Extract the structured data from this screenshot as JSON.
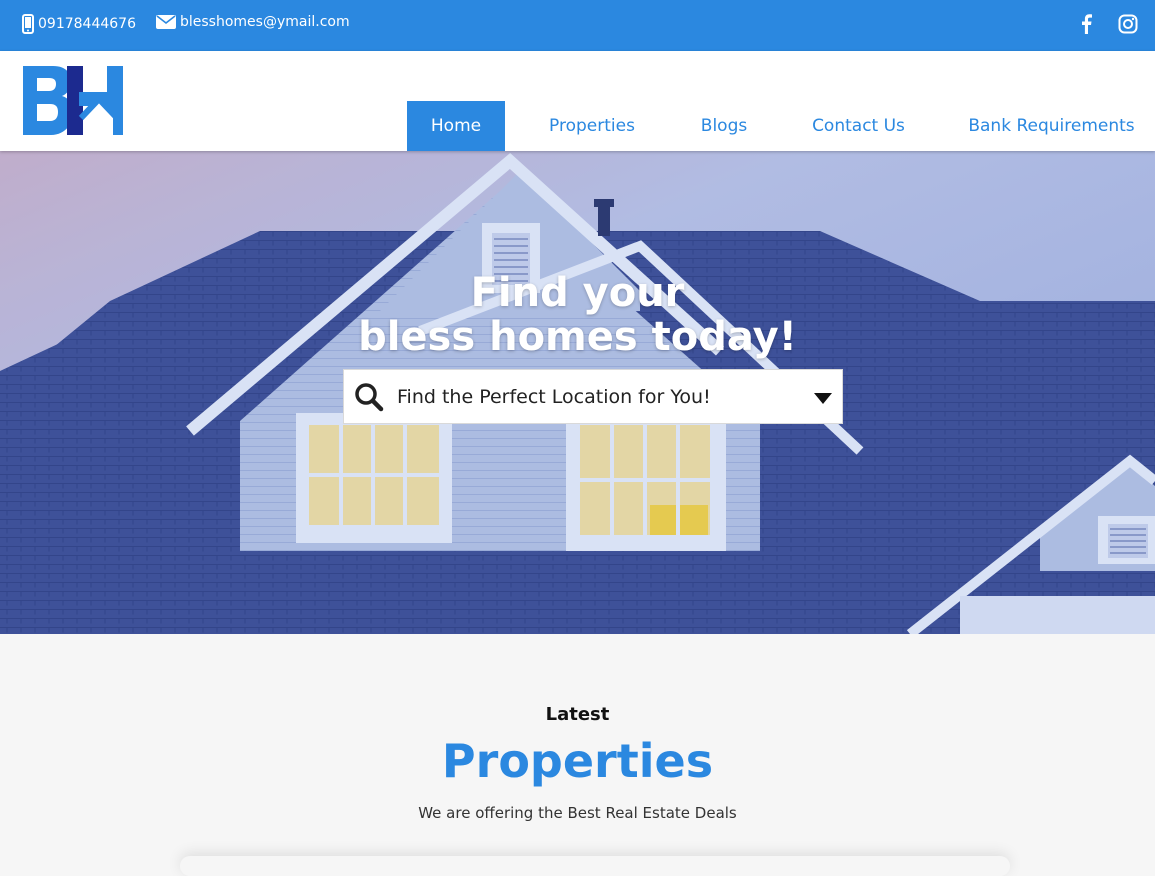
{
  "topbar": {
    "phone": "09178444676",
    "email": "blesshomes@ymail.com",
    "phone_icon": "mobile-phone-icon",
    "email_icon": "envelope-icon",
    "social": [
      "facebook-icon",
      "instagram-icon"
    ]
  },
  "header": {
    "logo_text": "BH",
    "nav": [
      {
        "label": "Home",
        "active": true
      },
      {
        "label": "Properties",
        "active": false
      },
      {
        "label": "Blogs",
        "active": false
      },
      {
        "label": "Contact Us",
        "active": false
      },
      {
        "label": "Bank Requirements",
        "active": false
      }
    ]
  },
  "hero": {
    "headline_line1": "Find your",
    "headline_line2": "bless homes today!",
    "search_placeholder": "Find the Perfect Location for You!",
    "search_icon": "search-icon",
    "dropdown_icon": "caret-down-icon"
  },
  "latest": {
    "kicker": "Latest",
    "title": "Properties",
    "subtitle": "We are offering the Best Real Estate Deals"
  },
  "colors": {
    "brand": "#2b88e0",
    "brand_dark": "#1c2a8f",
    "roof": "#3d4f98",
    "siding": "#b9c9ea"
  }
}
